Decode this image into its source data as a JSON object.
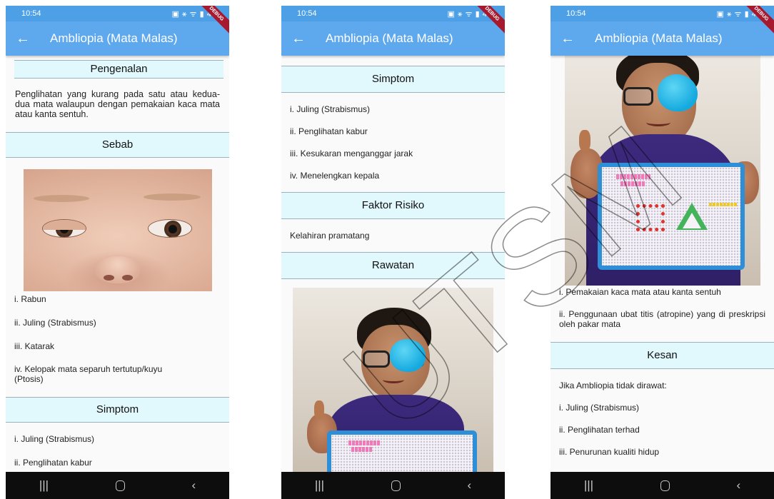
{
  "status": {
    "time": "10:54",
    "right": "▣ ⚹ ᯤ ▮ 41"
  },
  "debug_banner": "DEBUG",
  "app": {
    "title": "Ambliopia (Mata Malas)",
    "back_icon": "arrow-left-icon"
  },
  "screen1": {
    "pengenalan_title": "Pengenalan",
    "pengenalan_text": "Penglihatan yang kurang pada satu atau kedua-dua mata walaupun dengan pemakaian kaca mata atau kanta sentuh.",
    "sebab_title": "Sebab",
    "sebab_items": [
      "i. Rabun",
      "ii. Juling (Strabismus)",
      "iii. Katarak",
      "iv. Kelopak mata separuh tertutup/kuyu (Ptosis)"
    ],
    "simptom_title": "Simptom",
    "simptom_items": [
      "i. Juling (Strabismus)",
      "ii. Penglihatan kabur"
    ]
  },
  "screen2": {
    "simptom_title": "Simptom",
    "simptom_items": [
      "i. Juling (Strabismus)",
      "ii. Penglihatan kabur",
      "iii. Kesukaran menganggar jarak",
      "iv. Menelengkan kepala"
    ],
    "faktor_title": "Faktor Risiko",
    "faktor_text": "Kelahiran pramatang",
    "rawatan_title": "Rawatan"
  },
  "screen3": {
    "rawatan_items": [
      "i. Pemakaian kaca mata atau kanta sentuh",
      "ii. Penggunaan ubat titis (atropine) yang di preskripsi oleh pakar mata"
    ],
    "kesan_title": "Kesan",
    "kesan_intro": "Jika Ambliopia tidak dirawat:",
    "kesan_items": [
      "i. Juling (Strabismus)",
      "ii. Penglihatan terhad",
      "iii. Penurunan kualiti hidup"
    ]
  },
  "nav": {
    "recent": "|||",
    "back": "‹"
  },
  "watermark": "UTSM",
  "colors": {
    "appbar": "#5ea8ee",
    "section_bg": "#e1f8fd",
    "ribbon": "#a6192e",
    "patch": "#14a9df"
  }
}
